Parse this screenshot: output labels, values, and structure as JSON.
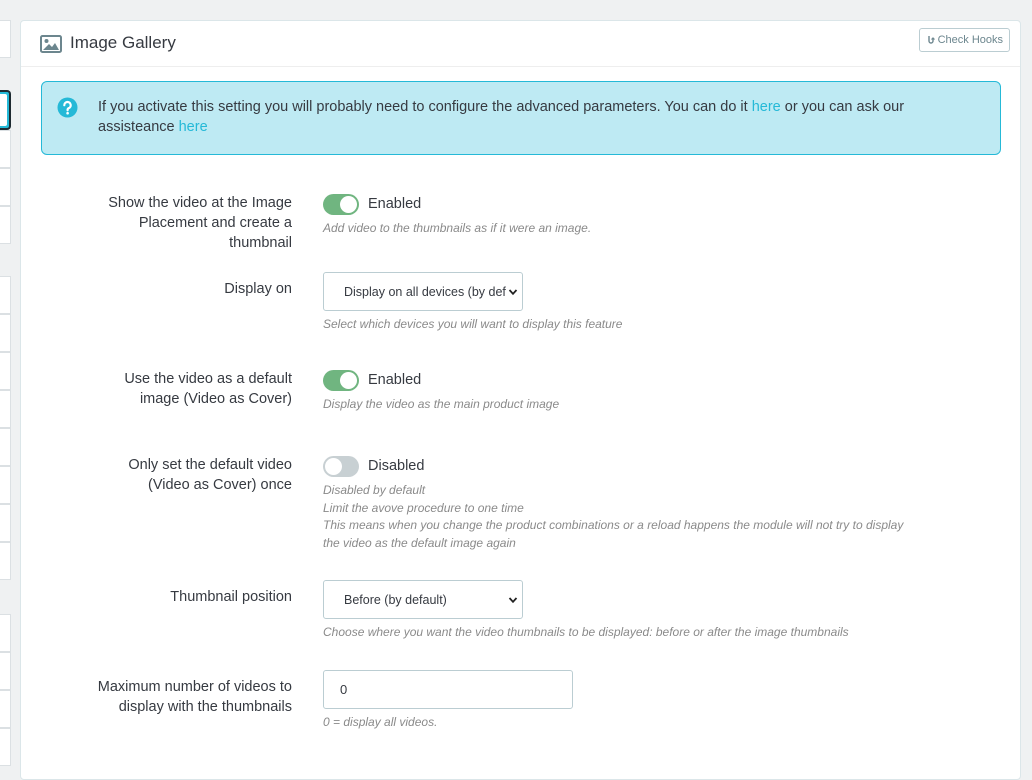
{
  "panel": {
    "title": "Image Gallery",
    "check_hooks_label": "Check Hooks"
  },
  "alert": {
    "text_before": "If you activate this setting you will probably need to configure the advanced parameters. You can do it ",
    "link1": "here",
    "text_middle": " or you can ask our assisteance ",
    "link2": "here"
  },
  "fields": {
    "show_video": {
      "label": "Show the video at the Image Placement and create a thumbnail",
      "state": "Enabled",
      "help": "Add video to the thumbnails as if it were an image."
    },
    "display_on": {
      "label": "Display on",
      "value": "Display on all devices (by default)",
      "help": "Select which devices you will want to display this feature"
    },
    "video_as_cover": {
      "label": "Use the video as a default image (Video as Cover)",
      "state": "Enabled",
      "help": "Display the video as the main product image"
    },
    "cover_once": {
      "label": "Only set the default video (Video as Cover) once",
      "state": "Disabled",
      "help1": "Disabled by default",
      "help2": "Limit the avove procedure to one time",
      "help3": "This means when you change the product combinations or a reload happens the module will not try to display the video as the default image again"
    },
    "thumb_position": {
      "label": "Thumbnail position",
      "value": "Before (by default)",
      "help": "Choose where you want the video thumbnails to be displayed: before or after the image thumbnails"
    },
    "max_videos": {
      "label": "Maximum number of videos to display with the thumbnails",
      "value": "0",
      "help": "0 = display all videos."
    }
  },
  "colors": {
    "accent": "#25b9d7",
    "toggle_on": "#70b580",
    "toggle_off": "#c8d0d3",
    "alert_bg": "#beeaf3"
  },
  "icons": {
    "heading": "image-icon",
    "hooks": "hook-icon",
    "alert": "question-circle-icon",
    "select": "chevron-down-icon"
  }
}
